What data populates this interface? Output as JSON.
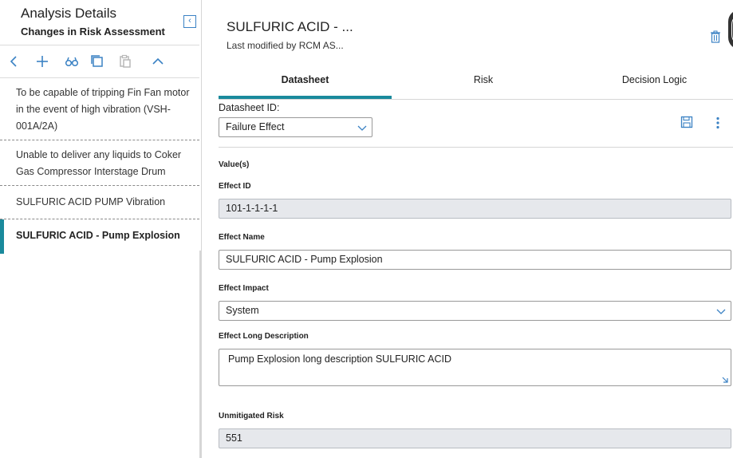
{
  "left_panel": {
    "title": "Analysis Details",
    "subtitle": "Changes in Risk Assessment",
    "collapse_glyph": "‹",
    "toolbar": [
      {
        "name": "back-icon",
        "glyph": "‹"
      },
      {
        "name": "add-icon",
        "glyph": "+"
      },
      {
        "name": "binoculars-icon",
        "glyph": "binoculars"
      },
      {
        "name": "copy-icon",
        "glyph": "copy"
      },
      {
        "name": "paste-icon",
        "glyph": "paste"
      },
      {
        "name": "chevron-up-icon",
        "glyph": "chevron-up"
      }
    ],
    "items": [
      {
        "label": "To be capable of tripping Fin Fan motor in the event of high vibration (VSH-001A/2A)"
      },
      {
        "label": "Unable to deliver any liquids to Coker Gas Compressor Interstage Drum"
      },
      {
        "label": "SULFURIC ACID PUMP Vibration"
      },
      {
        "label": "SULFURIC ACID - Pump Explosion"
      }
    ],
    "active_index": 3
  },
  "header": {
    "title": "SULFURIC ACID - ...",
    "subtitle": "Last modified by RCM AS..."
  },
  "tabs": [
    {
      "label": "Datasheet"
    },
    {
      "label": "Risk"
    },
    {
      "label": "Decision Logic"
    }
  ],
  "datasheet": {
    "id_label": "Datasheet ID:",
    "id_value": "Failure Effect",
    "section_label": "Value(s)",
    "effect_id_label": "Effect ID",
    "effect_id_value": "101-1-1-1-1",
    "effect_name_label": "Effect Name",
    "effect_name_value": "SULFURIC ACID - Pump Explosion",
    "effect_impact_label": "Effect Impact",
    "effect_impact_value": "System",
    "long_desc_label": "Effect Long Description",
    "long_desc_value": "Pump Explosion long description SULFURIC ACID",
    "unmitigated_risk_label": "Unmitigated Risk",
    "unmitigated_risk_value": "551"
  },
  "colors": {
    "accent": "#1a8a9c",
    "icon_blue": "#3b82c4",
    "readonly_bg": "#e6e8ec"
  }
}
